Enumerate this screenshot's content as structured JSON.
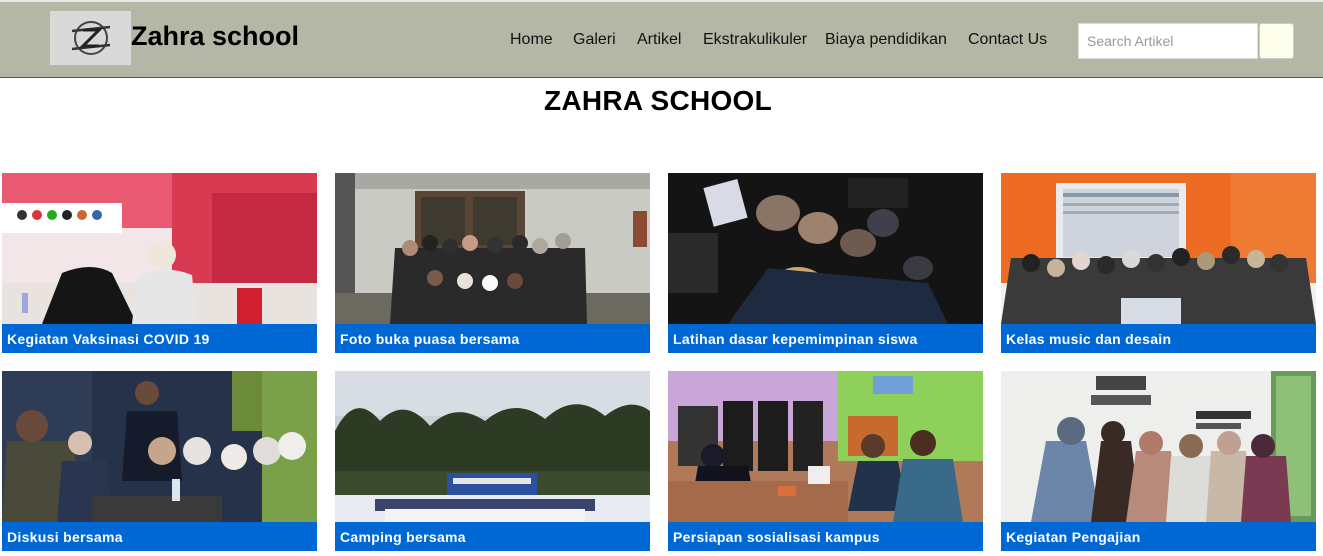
{
  "header": {
    "brand": "Zahra school",
    "nav": [
      "Home",
      "Galeri",
      "Artikel",
      "Ekstrakulikuler",
      "Biaya pendidikan",
      "Contact Us"
    ],
    "search_placeholder": "Search Artikel"
  },
  "main": {
    "title": "ZAHRA SCHOOL",
    "cards": [
      {
        "caption": "Kegiatan Vaksinasi COVID 19"
      },
      {
        "caption": "Foto buka puasa bersama"
      },
      {
        "caption": "Latihan dasar kepemimpinan siswa"
      },
      {
        "caption": "Kelas music dan desain"
      },
      {
        "caption": "Diskusi bersama"
      },
      {
        "caption": "Camping bersama"
      },
      {
        "caption": "Persiapan sosialisasi kampus"
      },
      {
        "caption": "Kegiatan Pengajian"
      }
    ]
  },
  "colors": {
    "navbar": "#b5b7a6",
    "caption_bar": "#0068d4",
    "search_button": "#fcfdea"
  }
}
